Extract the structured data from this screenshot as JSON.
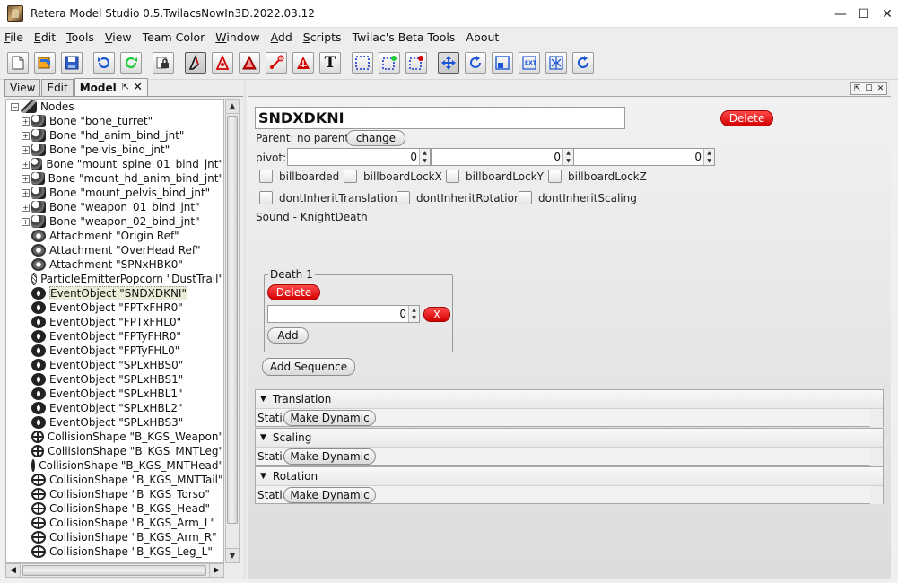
{
  "window": {
    "title": "Retera Model Studio 0.5.TwilacsNowIn3D.2022.03.12",
    "controls": [
      "—",
      "☐",
      "✕"
    ]
  },
  "menu": [
    {
      "label": "File",
      "u": "F",
      "rest": "ile"
    },
    {
      "label": "Edit",
      "u": "E",
      "rest": "dit"
    },
    {
      "label": "Tools",
      "u": "T",
      "rest": "ools"
    },
    {
      "label": "View",
      "u": "V",
      "rest": "iew"
    },
    {
      "label": "Team Color",
      "u": "",
      "rest": "Team Color"
    },
    {
      "label": "Window",
      "u": "W",
      "rest": "indow"
    },
    {
      "label": "Add",
      "u": "A",
      "rest": "dd"
    },
    {
      "label": "Scripts",
      "u": "S",
      "rest": "cripts"
    },
    {
      "label": "Twilac's Beta Tools",
      "u": "",
      "rest": "Twilac's Beta Tools"
    },
    {
      "label": "About",
      "u": "",
      "rest": "About"
    }
  ],
  "left_tabs": {
    "view": "View",
    "edit": "Edit",
    "model": "Model",
    "pin": "⇱",
    "close": "✕"
  },
  "tree": {
    "root": "Nodes",
    "items": [
      {
        "type": "bone",
        "text": "Bone \"bone_turret\"",
        "expandable": true
      },
      {
        "type": "bone",
        "text": "Bone \"hd_anim_bind_jnt\"",
        "expandable": true
      },
      {
        "type": "bone",
        "text": "Bone \"pelvis_bind_jnt\"",
        "expandable": true
      },
      {
        "type": "bone",
        "text": "Bone \"mount_spine_01_bind_jnt\"",
        "expandable": true
      },
      {
        "type": "bone",
        "text": "Bone \"mount_hd_anim_bind_jnt\"",
        "expandable": true
      },
      {
        "type": "bone",
        "text": "Bone \"mount_pelvis_bind_jnt\"",
        "expandable": true
      },
      {
        "type": "bone",
        "text": "Bone \"weapon_01_bind_jnt\"",
        "expandable": true
      },
      {
        "type": "bone",
        "text": "Bone \"weapon_02_bind_jnt\"",
        "expandable": true
      },
      {
        "type": "att",
        "text": "Attachment \"Origin Ref\"",
        "expandable": false
      },
      {
        "type": "att",
        "text": "Attachment \"OverHead Ref\"",
        "expandable": false
      },
      {
        "type": "att",
        "text": "Attachment \"SPNxHBK0\"",
        "expandable": false
      },
      {
        "type": "part",
        "text": "ParticleEmitterPopcorn \"DustTrail\"",
        "expandable": false
      },
      {
        "type": "event",
        "text": "EventObject \"SNDXDKNI\"",
        "expandable": false,
        "selected": true
      },
      {
        "type": "event",
        "text": "EventObject \"FPTxFHR0\"",
        "expandable": false
      },
      {
        "type": "event",
        "text": "EventObject \"FPTxFHL0\"",
        "expandable": false
      },
      {
        "type": "event",
        "text": "EventObject \"FPTyFHR0\"",
        "expandable": false
      },
      {
        "type": "event",
        "text": "EventObject \"FPTyFHL0\"",
        "expandable": false
      },
      {
        "type": "event",
        "text": "EventObject \"SPLxHBS0\"",
        "expandable": false
      },
      {
        "type": "event",
        "text": "EventObject \"SPLxHBS1\"",
        "expandable": false
      },
      {
        "type": "event",
        "text": "EventObject \"SPLxHBL1\"",
        "expandable": false
      },
      {
        "type": "event",
        "text": "EventObject \"SPLxHBL2\"",
        "expandable": false
      },
      {
        "type": "event",
        "text": "EventObject \"SPLxHBS3\"",
        "expandable": false
      },
      {
        "type": "coll",
        "text": "CollisionShape \"B_KGS_Weapon\"",
        "expandable": false
      },
      {
        "type": "coll",
        "text": "CollisionShape \"B_KGS_MNTLeg\"",
        "expandable": false
      },
      {
        "type": "coll",
        "text": "CollisionShape \"B_KGS_MNTHead\"",
        "expandable": false
      },
      {
        "type": "coll",
        "text": "CollisionShape \"B_KGS_MNTTail\"",
        "expandable": false
      },
      {
        "type": "coll",
        "text": "CollisionShape \"B_KGS_Torso\"",
        "expandable": false
      },
      {
        "type": "coll",
        "text": "CollisionShape \"B_KGS_Head\"",
        "expandable": false
      },
      {
        "type": "coll",
        "text": "CollisionShape \"B_KGS_Arm_L\"",
        "expandable": false
      },
      {
        "type": "coll",
        "text": "CollisionShape \"B_KGS_Arm_R\"",
        "expandable": false
      },
      {
        "type": "coll",
        "text": "CollisionShape \"B_KGS_Leg_L\"",
        "expandable": false
      }
    ]
  },
  "editor": {
    "name_value": "SNDXDKNI",
    "delete_label": "Delete",
    "parent_label": "Parent:",
    "parent_value": "no parent",
    "change_label": "change",
    "pivot_label": "pivot:",
    "pivot_values": [
      "0",
      "0",
      "0"
    ],
    "checkboxes": [
      "billboarded",
      "billboardLockX",
      "billboardLockY",
      "billboardLockZ",
      "dontInheritTranslation",
      "dontInheritRotation",
      "dontInheritScaling"
    ],
    "sound_label": "Sound - KnightDeath",
    "track": {
      "legend": "Death 1",
      "delete_label": "Delete",
      "value": "0",
      "x_label": "X",
      "add_label": "Add"
    },
    "add_sequence_label": "Add Sequence",
    "sections": [
      {
        "title": "Translation",
        "static": "Static",
        "button": "Make Dynamic"
      },
      {
        "title": "Scaling",
        "static": "Static",
        "button": "Make Dynamic"
      },
      {
        "title": "Rotation",
        "static": "Static",
        "button": "Make Dynamic"
      }
    ]
  },
  "right_ctrls": [
    "⇱",
    "☐",
    "✕"
  ]
}
